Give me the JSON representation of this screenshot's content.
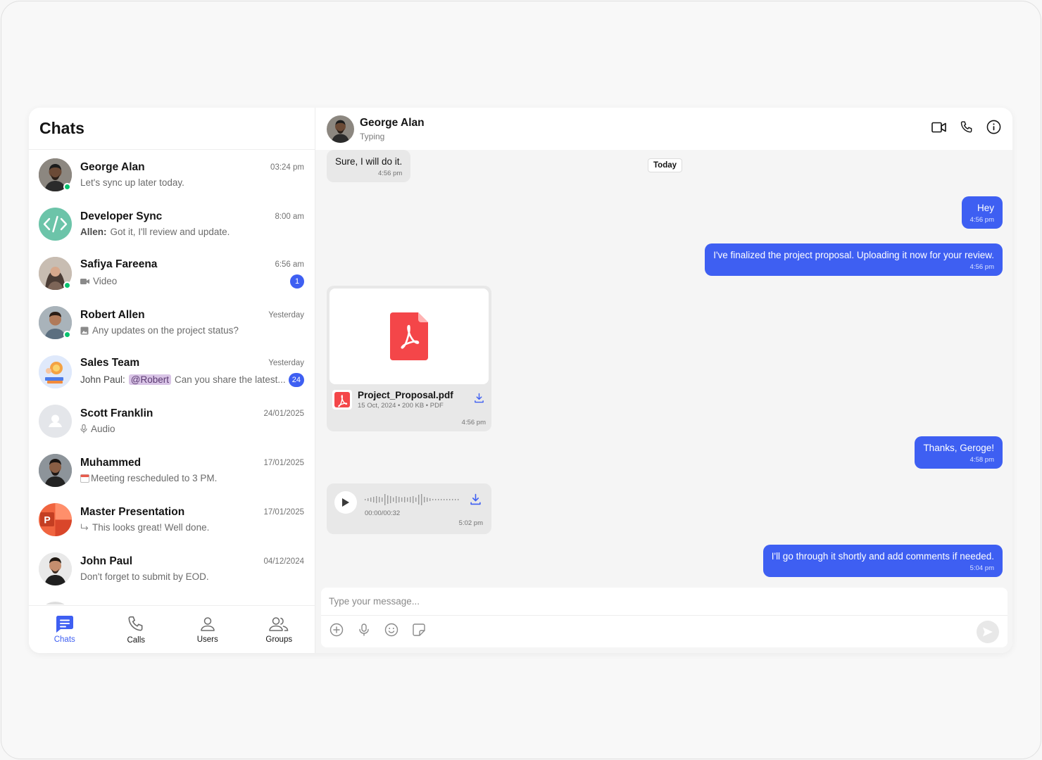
{
  "sidebar": {
    "title": "Chats",
    "chats": [
      {
        "name": "George Alan",
        "time": "03:24 pm",
        "preview": "Let's sync up later today.",
        "sender": "",
        "mention": "",
        "badge": ""
      },
      {
        "name": "Developer Sync",
        "time": "8:00 am",
        "preview": "Got it, I'll review and update.",
        "sender": "Allen:",
        "mention": "",
        "badge": ""
      },
      {
        "name": "Safiya Fareena",
        "time": "6:56 am",
        "preview": "Video",
        "sender": "",
        "mention": "",
        "badge": "1"
      },
      {
        "name": "Robert Allen",
        "time": "Yesterday",
        "preview": "Any updates on the project status?",
        "sender": "",
        "mention": "",
        "badge": ""
      },
      {
        "name": "Sales Team",
        "time": "Yesterday",
        "preview": "Can you share the latest...",
        "sender": "John Paul:",
        "mention": "@Robert",
        "badge": "24"
      },
      {
        "name": "Scott Franklin",
        "time": "24/01/2025",
        "preview": "Audio",
        "sender": "",
        "mention": "",
        "badge": ""
      },
      {
        "name": "Muhammed",
        "time": "17/01/2025",
        "preview": "Meeting rescheduled to 3 PM.",
        "sender": "",
        "mention": "",
        "badge": ""
      },
      {
        "name": "Master Presentation",
        "time": "17/01/2025",
        "preview": "This looks great! Well done.",
        "sender": "",
        "mention": "",
        "badge": ""
      },
      {
        "name": "John Paul",
        "time": "04/12/2024",
        "preview": "Don't forget to submit by EOD.",
        "sender": "",
        "mention": "",
        "badge": ""
      }
    ],
    "nav": {
      "chats": "Chats",
      "calls": "Calls",
      "users": "Users",
      "groups": "Groups"
    }
  },
  "conversation": {
    "contact_name": "George Alan",
    "contact_status": "Typing",
    "date_separator": "Today",
    "messages": {
      "m1": {
        "text": "Sure, I will do it.",
        "time": "4:56 pm"
      },
      "m2": {
        "text": "Hey",
        "time": "4:56 pm"
      },
      "m3": {
        "text": "I've finalized the project proposal. Uploading it now for your review.",
        "time": "4:56 pm"
      },
      "file": {
        "name": "Project_Proposal.pdf",
        "meta": "15 Oct, 2024 • 200 KB • PDF",
        "time": "4:56 pm"
      },
      "m4": {
        "text": "Thanks, Geroge!",
        "time": "4:58 pm"
      },
      "audio": {
        "duration": "00:00/00:32",
        "time": "5:02 pm"
      },
      "m5": {
        "text": "I'll go through it shortly and add comments if needed.",
        "time": "5:04 pm"
      }
    },
    "composer": {
      "placeholder": "Type your message..."
    }
  },
  "colors": {
    "accent": "#3e5ff2",
    "incoming_bubble": "#e8e8e8",
    "online": "#09c26f",
    "pdf_red": "#f44649"
  }
}
